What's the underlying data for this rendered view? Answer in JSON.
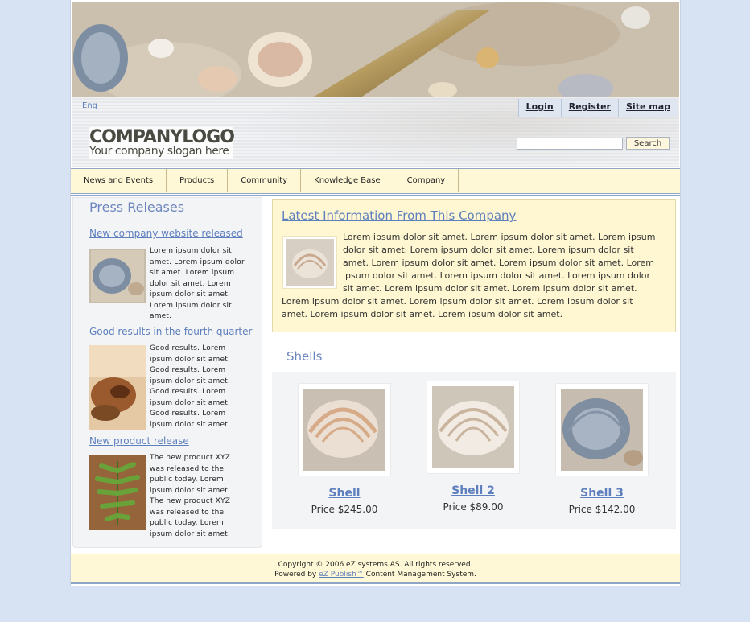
{
  "header": {
    "lang": "Eng",
    "top_links": [
      "Login",
      "Register",
      "Site map"
    ],
    "logo_line1": "COMPANYLOGO",
    "logo_line2": "Your company slogan here",
    "search_placeholder": "",
    "search_button": "Search"
  },
  "nav": {
    "items": [
      "News and Events",
      "Products",
      "Community",
      "Knowledge Base",
      "Company"
    ]
  },
  "press": {
    "title": "Press Releases",
    "items": [
      {
        "title": "New company website released",
        "text": "Lorem ipsum dolor sit amet. Lorem ipsum dolor sit amet. Lorem ipsum dolor sit amet. Lorem ipsum dolor sit amet. Lorem ipsum dolor sit amet.",
        "image": "blue-shell-thumbnail"
      },
      {
        "title": "Good results in the fourth quarter",
        "text": "Good results. Lorem ipsum dolor sit amet. Good results. Lorem ipsum dolor sit amet. Good results. Lorem ipsum dolor sit amet. Good results. Lorem ipsum dolor sit amet.",
        "image": "star-anise-thumbnail"
      },
      {
        "title": "New product release",
        "text": "The new product XYZ was released to the public today. Lorem ipsum dolor sit amet. The new product XYZ was released to the public today. Lorem ipsum dolor sit amet.",
        "image": "fern-leaf-thumbnail"
      }
    ]
  },
  "latest": {
    "title": "Latest Information From This Company",
    "text": "Lorem ipsum dolor sit amet. Lorem ipsum dolor sit amet. Lorem ipsum dolor sit amet. Lorem ipsum dolor sit amet. Lorem ipsum dolor sit amet. Lorem ipsum dolor sit amet. Lorem ipsum dolor sit amet. Lorem ipsum dolor sit amet. Lorem ipsum dolor sit amet. Lorem ipsum dolor sit amet. Lorem ipsum dolor sit amet. Lorem ipsum dolor sit amet. Lorem ipsum dolor sit amet. Lorem ipsum dolor sit amet. Lorem ipsum dolor sit amet. Lorem ipsum dolor sit amet. Lorem ipsum dolor sit amet."
  },
  "shells": {
    "title": "Shells",
    "items": [
      {
        "name": "Shell",
        "price": "Price $245.00"
      },
      {
        "name": "Shell 2",
        "price": "Price $89.00"
      },
      {
        "name": "Shell 3",
        "price": "Price $142.00"
      }
    ]
  },
  "footer": {
    "line1": "Copyright © 2006 eZ systems AS. All rights reserved.",
    "line2_prefix": "Powered by",
    "line2_link": "eZ Publish™",
    "line2_suffix": "Content Management System."
  }
}
